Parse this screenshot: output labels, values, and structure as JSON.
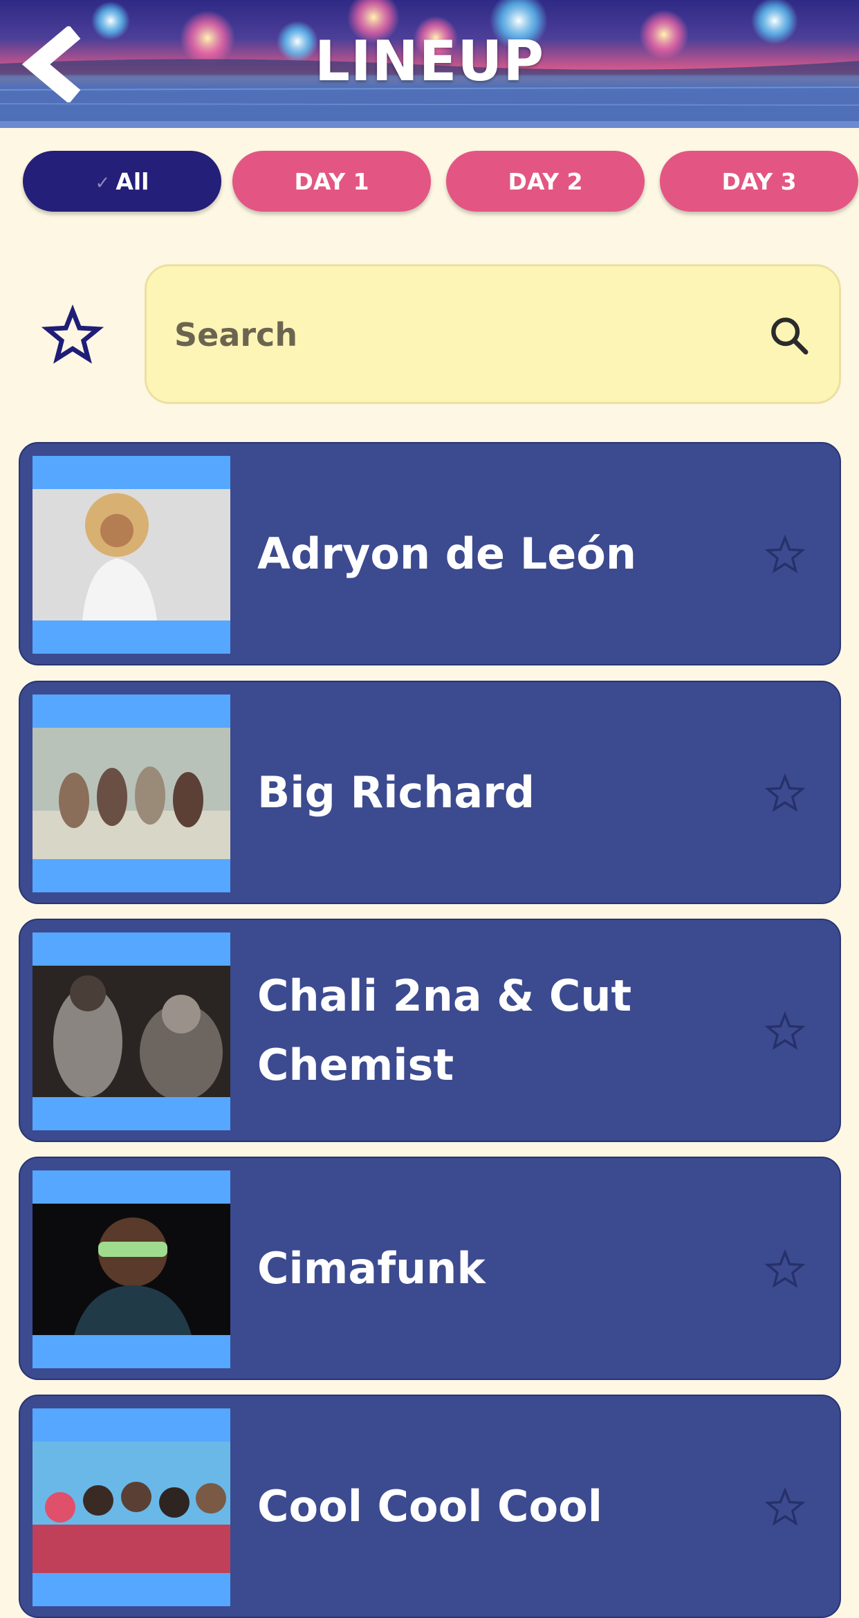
{
  "header": {
    "title": "LINEUP",
    "back_icon": "chevron-left-icon"
  },
  "filters": {
    "chips": [
      {
        "label": "All",
        "selected": true
      },
      {
        "label": "DAY 1",
        "selected": false
      },
      {
        "label": "DAY 2",
        "selected": false
      },
      {
        "label": "DAY 3",
        "selected": false
      }
    ],
    "check_glyph": "✓"
  },
  "search": {
    "placeholder": "Search",
    "value": ""
  },
  "artists": [
    {
      "name": "Adryon de León",
      "favorited": false
    },
    {
      "name": "Big Richard",
      "favorited": false
    },
    {
      "name": "Chali 2na & Cut Chemist",
      "favorited": false
    },
    {
      "name": "Cimafunk",
      "favorited": false
    },
    {
      "name": "Cool Cool Cool",
      "favorited": false
    }
  ],
  "colors": {
    "background": "#fdf7e3",
    "chip_active": "#241f78",
    "chip_inactive": "#e35683",
    "card": "#3c4a8f",
    "thumb_frame": "#56a7ff",
    "search_bg": "#fdf5b6"
  }
}
